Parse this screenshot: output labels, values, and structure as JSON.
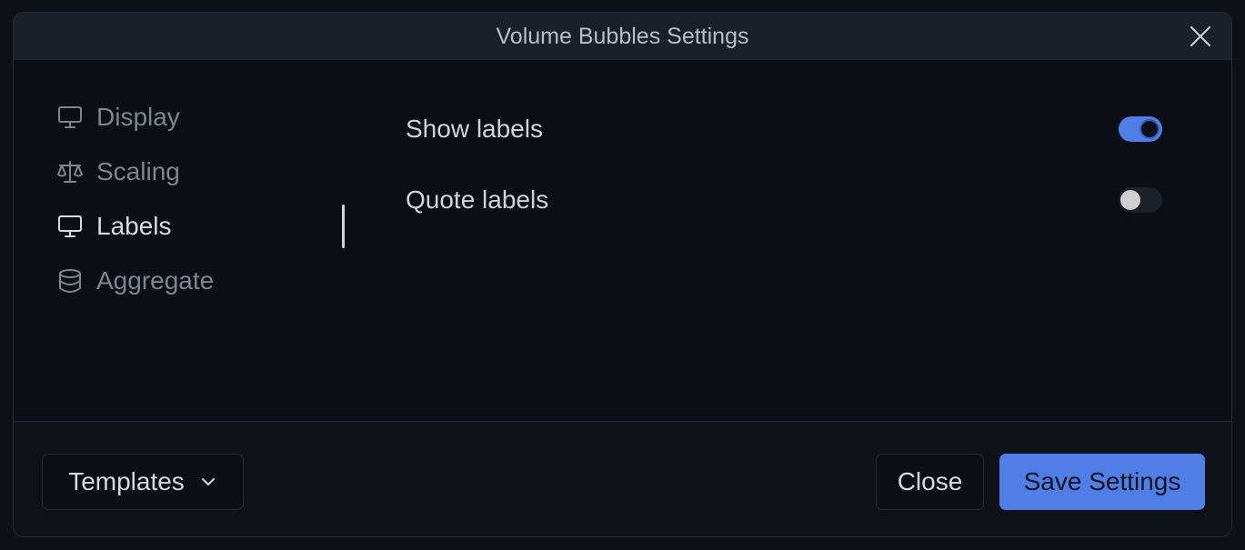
{
  "dialog": {
    "title": "Volume Bubbles Settings",
    "close_icon": "close-icon"
  },
  "sidebar": {
    "items": [
      {
        "label": "Display",
        "icon": "monitor-icon",
        "active": false
      },
      {
        "label": "Scaling",
        "icon": "scale-icon",
        "active": false
      },
      {
        "label": "Labels",
        "icon": "monitor-icon",
        "active": true
      },
      {
        "label": "Aggregate",
        "icon": "database-icon",
        "active": false
      }
    ]
  },
  "settings": {
    "show_labels": {
      "label": "Show labels",
      "enabled": true
    },
    "quote_labels": {
      "label": "Quote labels",
      "enabled": false
    }
  },
  "footer": {
    "templates_label": "Templates",
    "close_label": "Close",
    "save_label": "Save Settings"
  },
  "colors": {
    "accent": "#4f7fe6",
    "background": "#0b0e14",
    "titlebar": "#1b1f29"
  }
}
